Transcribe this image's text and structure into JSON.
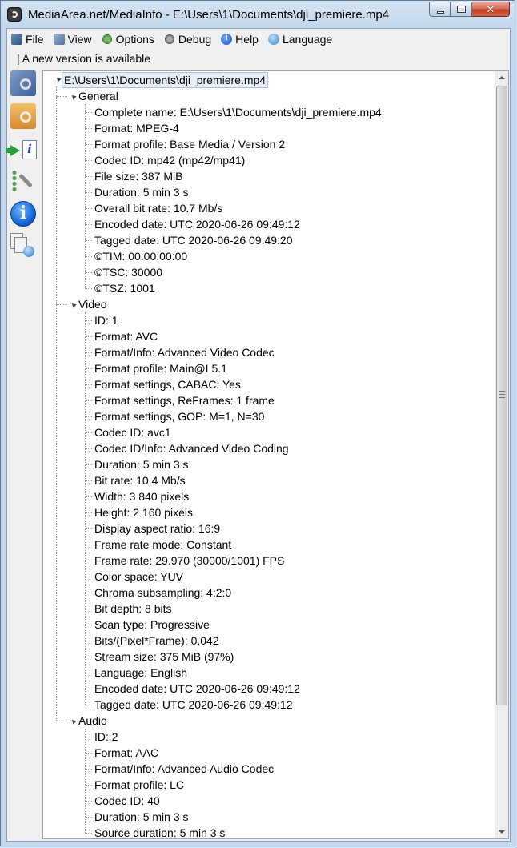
{
  "window": {
    "title": "MediaArea.net/MediaInfo - E:\\Users\\1\\Documents\\dji_premiere.mp4"
  },
  "menu": [
    {
      "label": "File",
      "icon": "file-icon"
    },
    {
      "label": "View",
      "icon": "view-icon"
    },
    {
      "label": "Options",
      "icon": "options-icon"
    },
    {
      "label": "Debug",
      "icon": "debug-icon"
    },
    {
      "label": "Help",
      "icon": "help-icon"
    },
    {
      "label": "Language",
      "icon": "language-icon"
    }
  ],
  "notice": "| A new version is available",
  "toolbar": [
    {
      "name": "open-file-icon"
    },
    {
      "name": "open-folder-icon"
    },
    {
      "name": "export-icon"
    },
    {
      "name": "preferences-icon"
    },
    {
      "name": "about-icon"
    },
    {
      "name": "web-icon"
    }
  ],
  "tree": {
    "root": "E:\\Users\\1\\Documents\\dji_premiere.mp4",
    "sections": [
      {
        "label": "General",
        "fields": [
          "Complete name: E:\\Users\\1\\Documents\\dji_premiere.mp4",
          "Format: MPEG-4",
          "Format profile: Base Media / Version 2",
          "Codec ID: mp42 (mp42/mp41)",
          "File size: 387 MiB",
          "Duration: 5 min 3 s",
          "Overall bit rate: 10.7 Mb/s",
          "Encoded date: UTC 2020-06-26 09:49:12",
          "Tagged date: UTC 2020-06-26 09:49:20",
          "©TIM: 00:00:00:00",
          "©TSC: 30000",
          "©TSZ: 1001"
        ]
      },
      {
        "label": "Video",
        "fields": [
          "ID: 1",
          "Format: AVC",
          "Format/Info: Advanced Video Codec",
          "Format profile: Main@L5.1",
          "Format settings, CABAC: Yes",
          "Format settings, ReFrames: 1 frame",
          "Format settings, GOP: M=1, N=30",
          "Codec ID: avc1",
          "Codec ID/Info: Advanced Video Coding",
          "Duration: 5 min 3 s",
          "Bit rate: 10.4 Mb/s",
          "Width: 3 840 pixels",
          "Height: 2 160 pixels",
          "Display aspect ratio: 16:9",
          "Frame rate mode: Constant",
          "Frame rate: 29.970 (30000/1001) FPS",
          "Color space: YUV",
          "Chroma subsampling: 4:2:0",
          "Bit depth: 8 bits",
          "Scan type: Progressive",
          "Bits/(Pixel*Frame): 0.042",
          "Stream size: 375 MiB (97%)",
          "Language: English",
          "Encoded date: UTC 2020-06-26 09:49:12",
          "Tagged date: UTC 2020-06-26 09:49:12"
        ]
      },
      {
        "label": "Audio",
        "fields": [
          "ID: 2",
          "Format: AAC",
          "Format/Info: Advanced Audio Codec",
          "Format profile: LC",
          "Codec ID: 40",
          "Duration: 5 min 3 s",
          "Source duration: 5 min 3 s"
        ]
      }
    ]
  }
}
